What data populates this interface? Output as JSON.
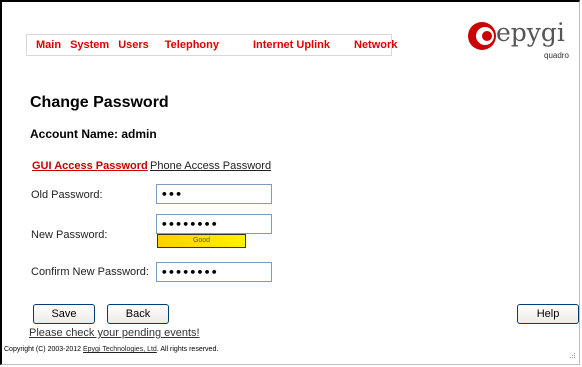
{
  "nav": [
    "Main",
    "System",
    "Users",
    "Telephony",
    "Internet Uplink",
    "Network"
  ],
  "logo": {
    "word": "epygi",
    "sub": "quadro",
    "brand_color": "#cc0000"
  },
  "page_title": "Change Password",
  "account": "Account Name: admin",
  "tabs": {
    "active": "GUI Access Password",
    "other": "Phone Access Password"
  },
  "form": {
    "old_label": "Old Password:",
    "old_value": "•••",
    "new_label": "New Password:",
    "new_value": "••••••••",
    "strength": "Good",
    "confirm_label": "Confirm New Password:",
    "confirm_value": "••••••••"
  },
  "buttons": {
    "save": "Save",
    "back": "Back",
    "help": "Help"
  },
  "pending_link": "Please check your pending events!",
  "footer": {
    "prefix": "Copyright (C) 2003-2012 ",
    "company": "Epygi Technologies, Ltd",
    "suffix": ". All rights reserved."
  }
}
